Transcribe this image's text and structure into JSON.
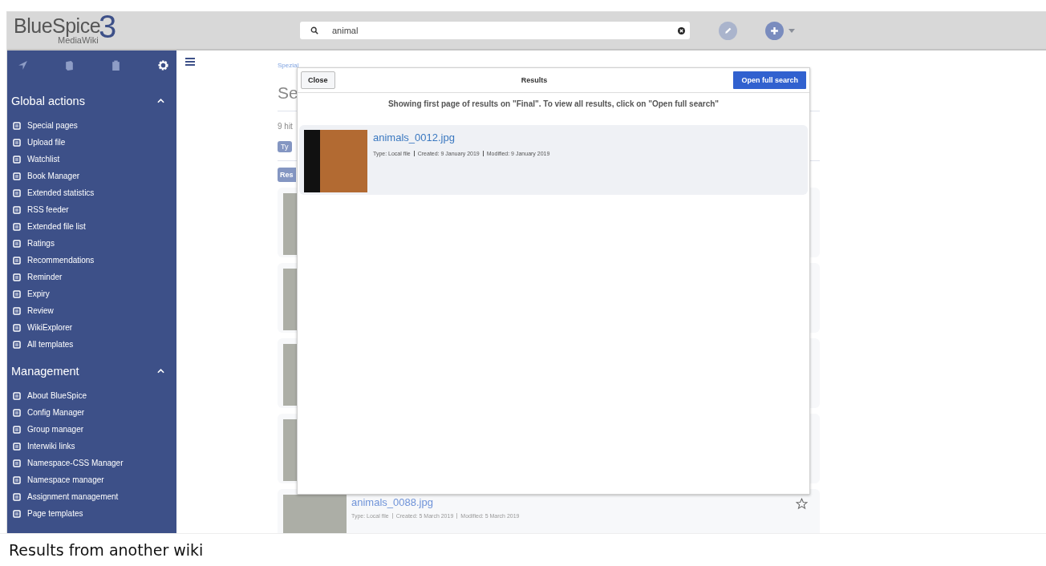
{
  "header": {
    "logo": "BlueSpice",
    "logo_sub": "MediaWiki",
    "logo_number": "3",
    "search": {
      "value": "animal"
    }
  },
  "sidebar": {
    "tabs": [
      {
        "selected": false
      },
      {
        "selected": false
      },
      {
        "selected": false
      },
      {
        "selected": true
      }
    ],
    "sections": [
      {
        "title": "Global actions",
        "expanded": true,
        "items": [
          "Special pages",
          "Upload file",
          "Watchlist",
          "Book Manager",
          "Extended statistics",
          "RSS feeder",
          "Extended file list",
          "Ratings",
          "Recommendations",
          "Reminder",
          "Expiry",
          "Review",
          "WikiExplorer",
          "All templates"
        ]
      },
      {
        "title": "Management",
        "expanded": true,
        "items": [
          "About BlueSpice",
          "Config Manager",
          "Group manager",
          "Interwiki links",
          "Namespace-CSS Manager",
          "Namespace manager",
          "Assignment management",
          "Page templates"
        ]
      }
    ]
  },
  "page": {
    "breadcrumb": "Spezial",
    "title": "Se",
    "hits": "9 hit",
    "filter_tag": "Ty",
    "results_header": "Res",
    "results": [
      {
        "kind": "covered"
      },
      {
        "kind": "covered"
      },
      {
        "kind": "covered"
      },
      {
        "kind": "covered"
      },
      {
        "kind": "file",
        "name": "animals_0088.jpg",
        "meta": [
          "Type: Local file",
          "Created: 5 March 2019",
          "Modified: 5 March 2019"
        ],
        "starred": false
      }
    ]
  },
  "modal": {
    "close": "Close",
    "title": "Results",
    "open_full": "Open full search",
    "notice": "Showing first page of results on \"Final\". To view all results, click on \"Open full search\"",
    "results": [
      {
        "name": "animals_0012.jpg",
        "meta": [
          "Type: Local file",
          "Created: 9 January 2019",
          "Modified: 9 January 2019"
        ]
      }
    ]
  },
  "caption": "Results from another wiki"
}
